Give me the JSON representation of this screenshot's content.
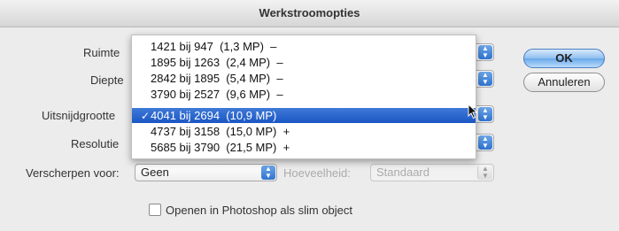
{
  "window": {
    "title": "Werkstroomopties"
  },
  "labels": {
    "ruimte": "Ruimte",
    "diepte": "Diepte",
    "uitsnijdgrootte": "Uitsnijdgrootte",
    "resolutie": "Resolutie",
    "verscherpen": "Verscherpen voor:",
    "hoeveelheid": "Hoeveelheid:"
  },
  "fields": {
    "verscherpen_value": "Geen",
    "hoeveelheid_value": "Standaard"
  },
  "buttons": {
    "ok": "OK",
    "cancel": "Annuleren"
  },
  "checkbox": {
    "label": "Openen in Photoshop als slim object",
    "checked": false
  },
  "dropdown": {
    "selected_index": 4,
    "items": [
      {
        "label": "1421 bij 947  (1,3 MP)  –"
      },
      {
        "label": "1895 bij 1263  (2,4 MP)  –"
      },
      {
        "label": "2842 bij 1895  (5,4 MP)  –"
      },
      {
        "label": "3790 bij 2527  (9,6 MP)  –"
      },
      {
        "label": "4041 bij 2694  (10,9 MP)"
      },
      {
        "label": "4737 bij 3158  (15,0 MP)  +"
      },
      {
        "label": "5685 bij 3790  (21,5 MP)  +"
      }
    ],
    "check_glyph": "✓"
  },
  "colors": {
    "accent": "#1b56c4",
    "default_button": "#6aa8ea"
  }
}
